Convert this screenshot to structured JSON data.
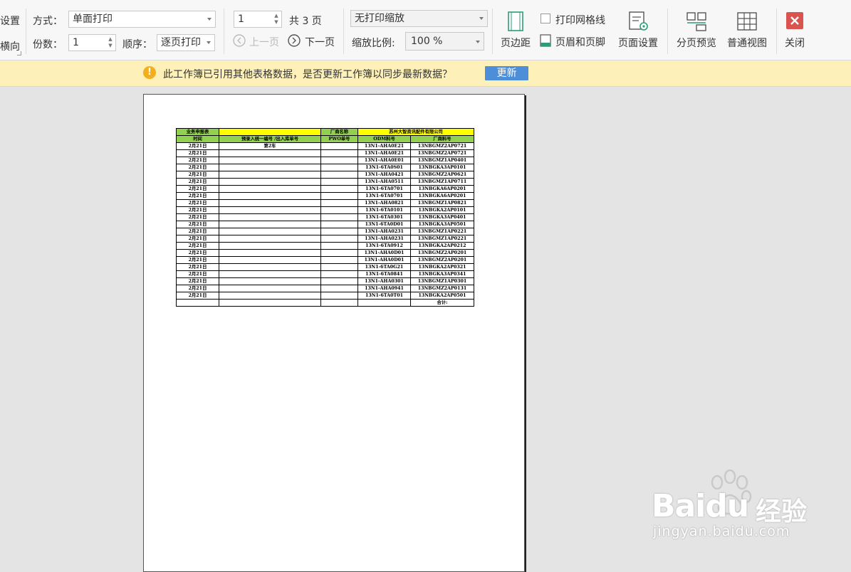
{
  "toolbar": {
    "cut_top_label": "设置",
    "cut_bottom_label": "横向",
    "mode_label": "方式：",
    "mode_value": "单面打印",
    "copies_label": "份数：",
    "copies_value": "1",
    "order_label": "顺序：",
    "order_value": "逐页打印",
    "page_input": "1",
    "page_total": "共 3 页",
    "prev_page": "上一页",
    "next_page": "下一页",
    "scaling_value": "无打印缩放",
    "zoom_label": "缩放比例:",
    "zoom_value": "100 %",
    "margins": "页边距",
    "print_gridlines": "打印网格线",
    "header_footer": "页眉和页脚",
    "page_setup": "页面设置",
    "page_break_preview": "分页预览",
    "normal_view": "普通视图",
    "close": "关闭"
  },
  "notice": {
    "text": "此工作簿已引用其他表格数据，是否更新工作簿以同步最新数据？",
    "button": "更新"
  },
  "sheet": {
    "title": "业务申报表",
    "vendor_label": "厂商名称",
    "vendor_name": "苏州大智资讯配件有限公司",
    "headers": [
      "时间",
      "预录入统一编号 /出入库单号",
      "PWO单号",
      "ODM料号",
      "厂商料号"
    ],
    "rows": [
      {
        "date": "2月21日",
        "note": "第2车",
        "odm": "13N1-AHA0E21",
        "vendor": "13NBGMZ2AP0721"
      },
      {
        "date": "2月21日",
        "note": "",
        "odm": "13N1-AHA0E21",
        "vendor": "13NBGMZ2AP0721"
      },
      {
        "date": "2月21日",
        "note": "",
        "odm": "13N1-AHA0E01",
        "vendor": "13NBGMZ1AP0401"
      },
      {
        "date": "2月21日",
        "note": "",
        "odm": "13N1-6TA0S01",
        "vendor": "13NBGKA3AP0101"
      },
      {
        "date": "2月21日",
        "note": "",
        "odm": "13N1-AHA0421",
        "vendor": "13NBGMZ2AP0621"
      },
      {
        "date": "2月21日",
        "note": "",
        "odm": "13N1-AHA0511",
        "vendor": "13NBGMZ1AP0711"
      },
      {
        "date": "2月21日",
        "note": "",
        "odm": "13N1-6TA0701",
        "vendor": "13NBGKA6AP0201"
      },
      {
        "date": "2月21日",
        "note": "",
        "odm": "13N1-6TA0701",
        "vendor": "13NBGKA6AP0201"
      },
      {
        "date": "2月21日",
        "note": "",
        "odm": "13N1-AHA0821",
        "vendor": "13NBGMZ1AP0821"
      },
      {
        "date": "2月21日",
        "note": "",
        "odm": "13N1-6TA0101",
        "vendor": "13NBGKA2AP0101"
      },
      {
        "date": "2月21日",
        "note": "",
        "odm": "13N1-6TA0301",
        "vendor": "13NBGKA3AP0401"
      },
      {
        "date": "2月21日",
        "note": "",
        "odm": "13N1-6TA0D01",
        "vendor": "13NBGKA3AP0501"
      },
      {
        "date": "2月21日",
        "note": "",
        "odm": "13N1-AHA0231",
        "vendor": "13NBGMZ1AP0221"
      },
      {
        "date": "2月21日",
        "note": "",
        "odm": "13N1-AHA0231",
        "vendor": "13NBGMZ1AP0221"
      },
      {
        "date": "2月21日",
        "note": "",
        "odm": "13N1-6TA0912",
        "vendor": "13NBGKA2AP0212"
      },
      {
        "date": "2月21日",
        "note": "",
        "odm": "13N1-AHA0D01",
        "vendor": "13NBGMZ2AP0201"
      },
      {
        "date": "2月21日",
        "note": "",
        "odm": "13N1-AHA0D01",
        "vendor": "13NBGMZ2AP0201"
      },
      {
        "date": "2月21日",
        "note": "",
        "odm": "13N1-6TA0G21",
        "vendor": "13NBGKA2AP0321"
      },
      {
        "date": "2月21日",
        "note": "",
        "odm": "13N1-6TA0841",
        "vendor": "13NBGKA3AP0341"
      },
      {
        "date": "2月21日",
        "note": "",
        "odm": "13N1-AHA0301",
        "vendor": "13NBGMZ1AP0301"
      },
      {
        "date": "2月21日",
        "note": "",
        "odm": "13N1-AHA0941",
        "vendor": "13NBGMZ2AP0131"
      },
      {
        "date": "2月21日",
        "note": "",
        "odm": "13N1-6TA0T01",
        "vendor": "13NBGKA2AP0501"
      }
    ],
    "total_label": "合计:"
  },
  "watermark": {
    "brand": "Baidu",
    "service": "经验",
    "url": "jingyan.baidu.com"
  },
  "colors": {
    "header_yellow": "#ffff00",
    "header_green": "#92d050",
    "notice_bg": "#fdf0b8",
    "update_button": "#4d8ed9",
    "close_red": "#d9534f"
  }
}
